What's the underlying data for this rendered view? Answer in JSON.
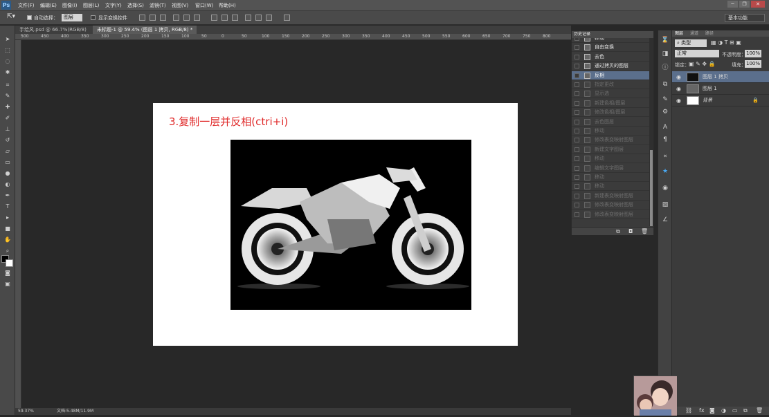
{
  "app": {
    "logo": "Ps"
  },
  "menu": [
    "文件(F)",
    "编辑(E)",
    "图像(I)",
    "图层(L)",
    "文字(Y)",
    "选择(S)",
    "滤镜(T)",
    "视图(V)",
    "窗口(W)",
    "帮助(H)"
  ],
  "window_controls": [
    "─",
    "❐",
    "✕"
  ],
  "options": {
    "auto_select_label": "自动选择：",
    "auto_select_value": "图层",
    "show_transform_label": "显示变换控件",
    "workspace": "基本功能"
  },
  "doc_tabs": [
    "手绘风.psd @ 66.7%(RGB/8)",
    "未标题-1 @ 59.4% (图层 1 拷贝, RGB/8) *"
  ],
  "ruler_ticks": [
    "500",
    "450",
    "400",
    "350",
    "300",
    "250",
    "200",
    "150",
    "100",
    "50",
    "0",
    "50",
    "100",
    "150",
    "200",
    "250",
    "300",
    "350",
    "400",
    "450",
    "500",
    "550",
    "600",
    "650",
    "700",
    "750",
    "800"
  ],
  "canvas": {
    "step_text": "3.复制一层并反相(ctri+i)"
  },
  "status": {
    "zoom": "59.37%",
    "doc_info": "文档:5.48M/11.9M"
  },
  "history": {
    "title": "历史记录",
    "items": [
      {
        "label": "移动",
        "state": "normal"
      },
      {
        "label": "自由变换",
        "state": "normal"
      },
      {
        "label": "去色",
        "state": "normal"
      },
      {
        "label": "通过拷贝的图层",
        "state": "normal"
      },
      {
        "label": "反相",
        "state": "active"
      },
      {
        "label": "指定更改",
        "state": "dim"
      },
      {
        "label": "显示选",
        "state": "dim"
      },
      {
        "label": "新建色相/图层",
        "state": "dim"
      },
      {
        "label": "修改色相/图层",
        "state": "dim"
      },
      {
        "label": "去色图层",
        "state": "dim"
      },
      {
        "label": "移动",
        "state": "dim"
      },
      {
        "label": "修改表变映射图层",
        "state": "dim"
      },
      {
        "label": "新建文字图层",
        "state": "dim"
      },
      {
        "label": "移动",
        "state": "dim"
      },
      {
        "label": "编辑文字图层",
        "state": "dim"
      },
      {
        "label": "移动",
        "state": "dim"
      },
      {
        "label": "移动",
        "state": "dim"
      },
      {
        "label": "新建表变映射图层",
        "state": "dim"
      },
      {
        "label": "修改表变映射图层",
        "state": "dim"
      },
      {
        "label": "修改表变映射图层",
        "state": "dim"
      }
    ]
  },
  "layers": {
    "tabs": [
      "图层",
      "通道",
      "路径"
    ],
    "filter": "类型",
    "blend_mode": "正常",
    "opacity_label": "不透明度：",
    "opacity": "100%",
    "lock_label": "锁定：",
    "fill_label": "填充：",
    "fill": "100%",
    "items": [
      {
        "name": "图层 1 拷贝",
        "selected": true
      },
      {
        "name": "图层 1",
        "selected": false
      },
      {
        "name": "背景",
        "selected": false
      }
    ]
  },
  "colors": {
    "accent_red": "#e02a2a",
    "selection": "#5b6f8c"
  }
}
